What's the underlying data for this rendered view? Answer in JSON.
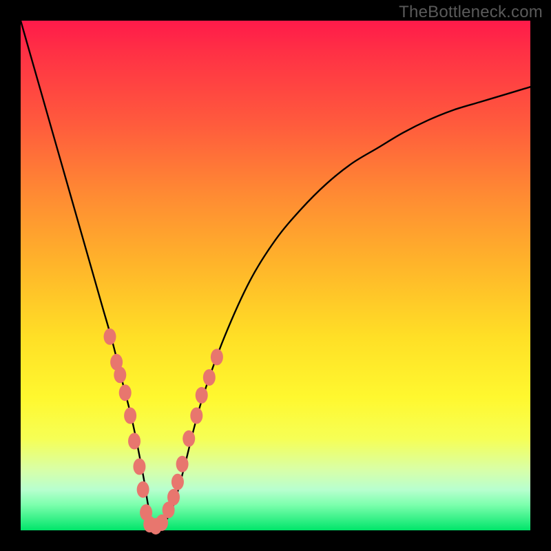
{
  "watermark": "TheBottleneck.com",
  "chart_data": {
    "type": "line",
    "title": "",
    "xlabel": "",
    "ylabel": "",
    "xlim": [
      0,
      100
    ],
    "ylim": [
      0,
      100
    ],
    "grid": false,
    "legend": false,
    "series": [
      {
        "name": "bottleneck-curve",
        "color": "#000000",
        "x": [
          0,
          2,
          4,
          6,
          8,
          10,
          12,
          14,
          16,
          18,
          20,
          22,
          24,
          25,
          26,
          27,
          28,
          30,
          32,
          34,
          36,
          40,
          45,
          50,
          55,
          60,
          65,
          70,
          75,
          80,
          85,
          90,
          95,
          100
        ],
        "y": [
          100,
          93,
          86,
          79,
          72,
          65,
          58,
          51,
          44,
          37,
          29,
          21,
          11,
          5,
          1,
          0,
          1,
          5,
          12,
          20,
          27,
          38,
          49,
          57,
          63,
          68,
          72,
          75,
          78,
          80.5,
          82.5,
          84,
          85.5,
          87
        ]
      }
    ],
    "markers": {
      "name": "highlighted-points",
      "color": "#e8766e",
      "points": [
        {
          "x": 17.5,
          "y": 38
        },
        {
          "x": 18.8,
          "y": 33
        },
        {
          "x": 19.5,
          "y": 30.5
        },
        {
          "x": 20.5,
          "y": 27
        },
        {
          "x": 21.5,
          "y": 22.5
        },
        {
          "x": 22.3,
          "y": 17.5
        },
        {
          "x": 23.3,
          "y": 12.5
        },
        {
          "x": 24.0,
          "y": 8
        },
        {
          "x": 24.6,
          "y": 3.5
        },
        {
          "x": 25.3,
          "y": 1.2
        },
        {
          "x": 26.5,
          "y": 0.8
        },
        {
          "x": 27.7,
          "y": 1.5
        },
        {
          "x": 29.0,
          "y": 4
        },
        {
          "x": 30.0,
          "y": 6.5
        },
        {
          "x": 30.8,
          "y": 9.5
        },
        {
          "x": 31.7,
          "y": 13
        },
        {
          "x": 33.0,
          "y": 18
        },
        {
          "x": 34.5,
          "y": 22.5
        },
        {
          "x": 35.5,
          "y": 26.5
        },
        {
          "x": 37.0,
          "y": 30
        },
        {
          "x": 38.5,
          "y": 34
        }
      ]
    }
  }
}
